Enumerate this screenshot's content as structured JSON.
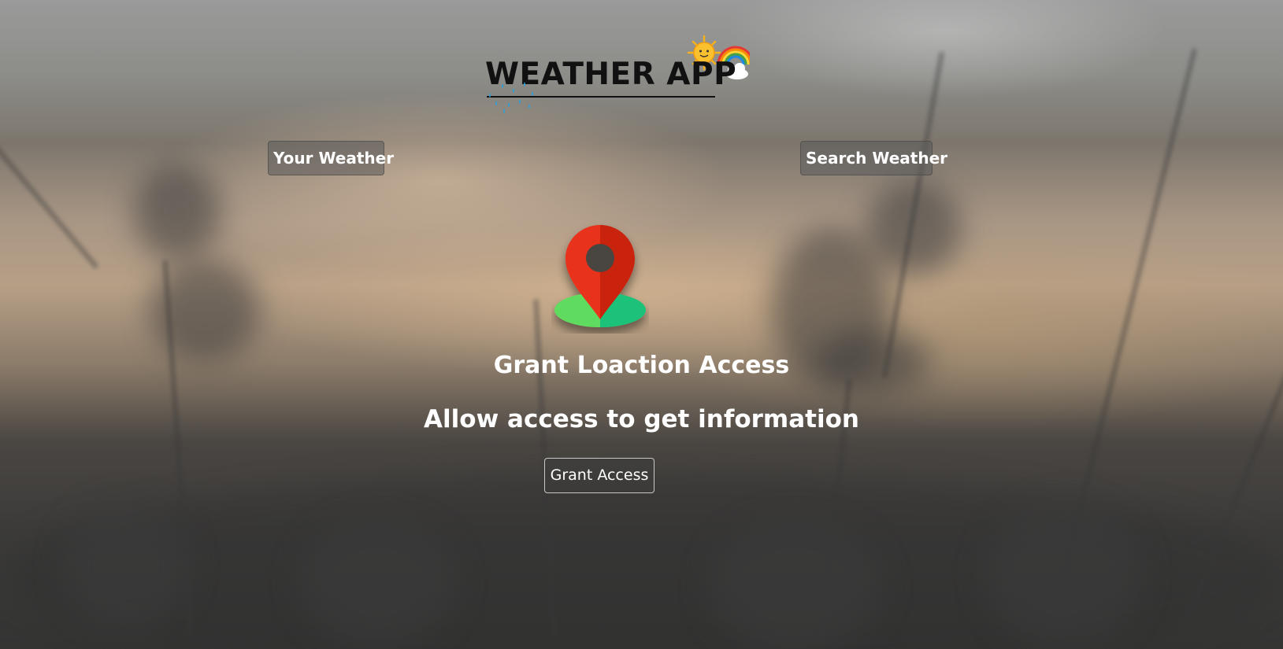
{
  "header": {
    "title": "WEATHER APP"
  },
  "tabs": [
    {
      "label": "Your Weather"
    },
    {
      "label": "Search Weather"
    }
  ],
  "grant_location": {
    "icon": "location-pin-icon",
    "title": "Grant Loaction Access",
    "subtitle": "Allow access to get information",
    "button_label": "Grant Access"
  },
  "icons": {
    "title_decoration_top": "sun-rainbow-cloud-icon",
    "title_decoration_bottom": "raindrops-icon"
  },
  "colors": {
    "pin_red": "#e8301c",
    "pin_dark_red": "#c9220f",
    "ground_green": "#5fdc60",
    "ground_teal": "#1ec27a",
    "text_white": "#ffffff",
    "title_black": "#111111"
  }
}
